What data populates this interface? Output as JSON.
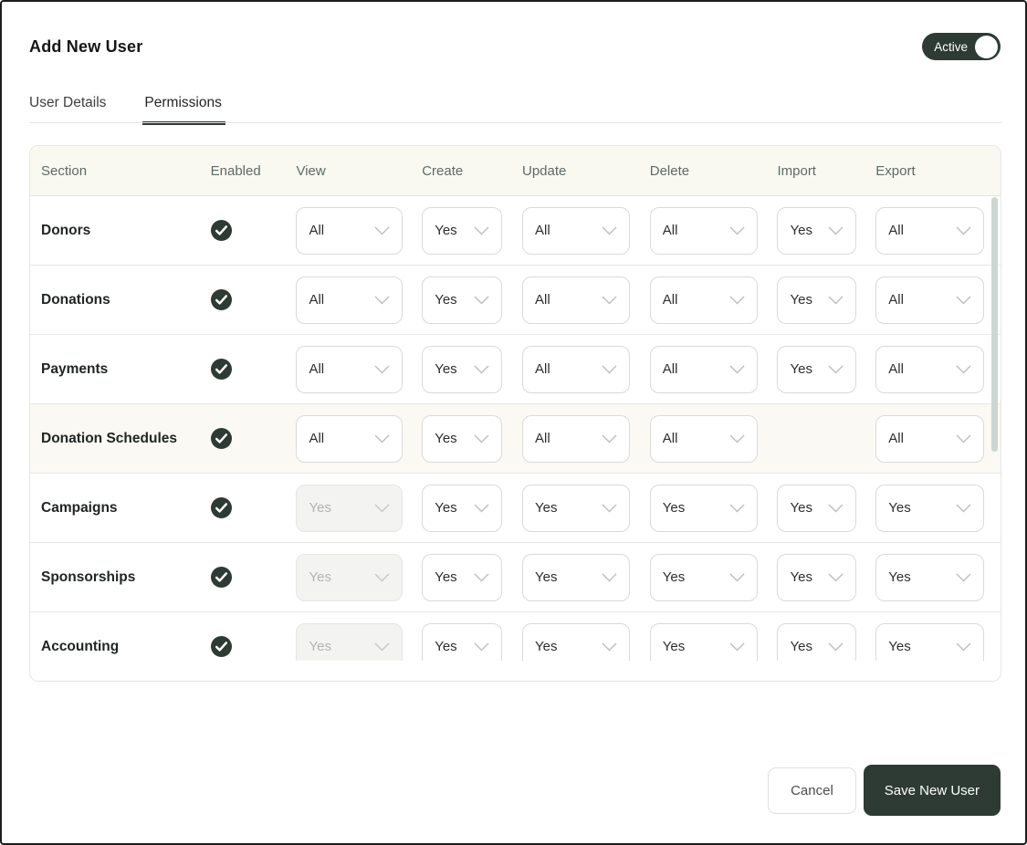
{
  "dialog": {
    "title": "Add New User",
    "status_toggle": {
      "label": "Active",
      "state": "on"
    },
    "tabs": [
      {
        "label": "User Details",
        "active": false
      },
      {
        "label": "Permissions",
        "active": true
      }
    ],
    "actions": {
      "cancel_label": "Cancel",
      "save_label": "Save New User"
    }
  },
  "permissions_table": {
    "columns": [
      "Section",
      "Enabled",
      "View",
      "Create",
      "Update",
      "Delete",
      "Import",
      "Export"
    ],
    "rows": [
      {
        "section": "Donors",
        "enabled": true,
        "highlighted": false,
        "permissions": {
          "view": {
            "value": "All"
          },
          "create": {
            "value": "Yes"
          },
          "update": {
            "value": "All"
          },
          "delete": {
            "value": "All"
          },
          "import": {
            "value": "Yes"
          },
          "export": {
            "value": "All"
          }
        }
      },
      {
        "section": "Donations",
        "enabled": true,
        "highlighted": false,
        "permissions": {
          "view": {
            "value": "All"
          },
          "create": {
            "value": "Yes"
          },
          "update": {
            "value": "All"
          },
          "delete": {
            "value": "All"
          },
          "import": {
            "value": "Yes"
          },
          "export": {
            "value": "All"
          }
        }
      },
      {
        "section": "Payments",
        "enabled": true,
        "highlighted": false,
        "permissions": {
          "view": {
            "value": "All"
          },
          "create": {
            "value": "Yes"
          },
          "update": {
            "value": "All"
          },
          "delete": {
            "value": "All"
          },
          "import": {
            "value": "Yes"
          },
          "export": {
            "value": "All"
          }
        }
      },
      {
        "section": "Donation Schedules",
        "enabled": true,
        "highlighted": true,
        "permissions": {
          "view": {
            "value": "All"
          },
          "create": {
            "value": "Yes"
          },
          "update": {
            "value": "All"
          },
          "delete": {
            "value": "All"
          },
          "import": null,
          "export": {
            "value": "All"
          }
        }
      },
      {
        "section": "Campaigns",
        "enabled": true,
        "highlighted": false,
        "permissions": {
          "view": {
            "value": "Yes",
            "disabled": true
          },
          "create": {
            "value": "Yes"
          },
          "update": {
            "value": "Yes"
          },
          "delete": {
            "value": "Yes"
          },
          "import": {
            "value": "Yes"
          },
          "export": {
            "value": "Yes"
          }
        }
      },
      {
        "section": "Sponsorships",
        "enabled": true,
        "highlighted": false,
        "permissions": {
          "view": {
            "value": "Yes",
            "disabled": true
          },
          "create": {
            "value": "Yes"
          },
          "update": {
            "value": "Yes"
          },
          "delete": {
            "value": "Yes"
          },
          "import": {
            "value": "Yes"
          },
          "export": {
            "value": "Yes"
          }
        }
      },
      {
        "section": "Accounting",
        "enabled": true,
        "highlighted": false,
        "permissions": {
          "view": {
            "value": "Yes",
            "disabled": true
          },
          "create": {
            "value": "Yes"
          },
          "update": {
            "value": "Yes"
          },
          "delete": {
            "value": "Yes"
          },
          "import": {
            "value": "Yes"
          },
          "export": {
            "value": "Yes"
          }
        }
      }
    ]
  },
  "icons": {
    "enabled": "check-circle-icon",
    "dropdown": "chevron-down-icon"
  },
  "colors": {
    "accent": "#2e3b35",
    "header_background": "#faf9f1",
    "highlight_row_background": "#faf9f3",
    "check_circle": "#2e3b34",
    "scrollbar_thumb": "#ccd6d3"
  }
}
